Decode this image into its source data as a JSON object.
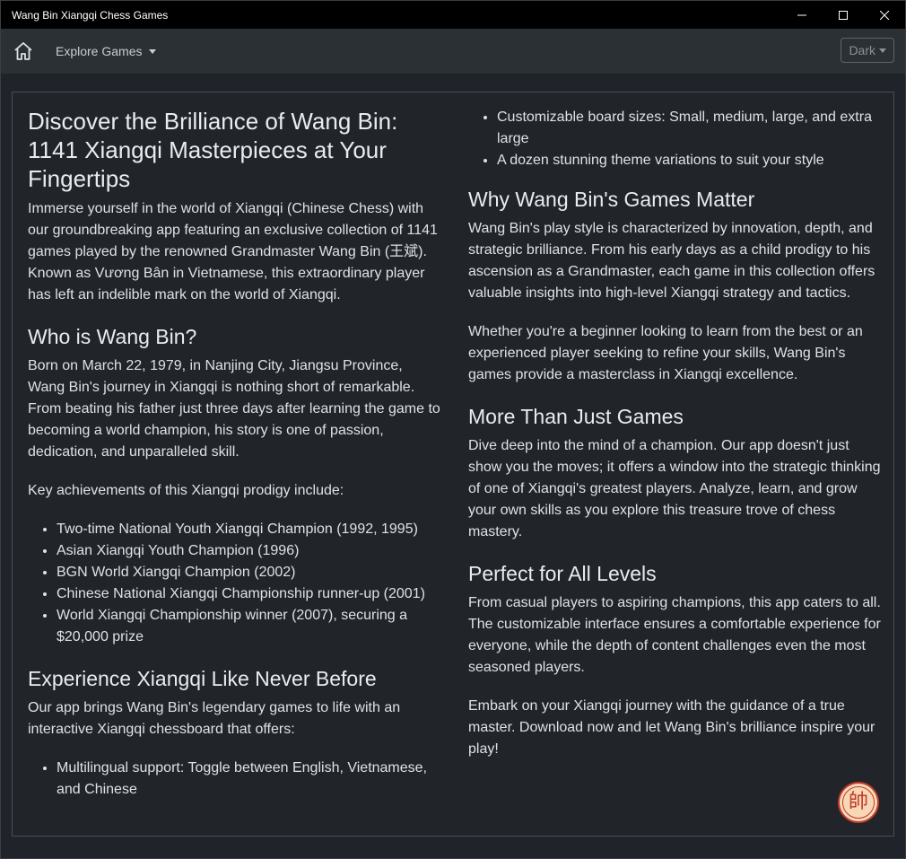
{
  "window": {
    "title": "Wang Bin Xiangqi Chess Games"
  },
  "navbar": {
    "explore_label": "Explore Games",
    "theme_label": "Dark"
  },
  "left": {
    "title": "Discover the Brilliance of Wang Bin: 1141 Xiangqi Masterpieces at Your Fingertips",
    "intro": "Immerse yourself in the world of Xiangqi (Chinese Chess) with our groundbreaking app featuring an exclusive collection of 1141 games played by the renowned Grandmaster Wang Bin (王斌). Known as Vương Bân in Vietnamese, this extraordinary player has left an indelible mark on the world of Xiangqi.",
    "who_heading": "Who is Wang Bin?",
    "who_text": "Born on March 22, 1979, in Nanjing City, Jiangsu Province, Wang Bin's journey in Xiangqi is nothing short of remarkable. From beating his father just three days after learning the game to becoming a world champion, his story is one of passion, dedication, and unparalleled skill.",
    "achievements_intro": "Key achievements of this Xiangqi prodigy include:",
    "achievements": [
      "Two-time National Youth Xiangqi Champion (1992, 1995)",
      "Asian Xiangqi Youth Champion (1996)",
      "BGN World Xiangqi Champion (2002)",
      "Chinese National Xiangqi Championship runner-up (2001)",
      "World Xiangqi Championship winner (2007), securing a $20,000 prize"
    ],
    "experience_heading": "Experience Xiangqi Like Never Before",
    "experience_text": "Our app brings Wang Bin's legendary games to life with an interactive Xiangqi chessboard that offers:",
    "features": [
      "Multilingual support: Toggle between English, Vietnamese, and Chinese"
    ]
  },
  "right": {
    "features": [
      "Customizable board sizes: Small, medium, large, and extra large",
      "A dozen stunning theme variations to suit your style"
    ],
    "why_heading": "Why Wang Bin's Games Matter",
    "why_text_1": "Wang Bin's play style is characterized by innovation, depth, and strategic brilliance. From his early days as a child prodigy to his ascension as a Grandmaster, each game in this collection offers valuable insights into high-level Xiangqi strategy and tactics.",
    "why_text_2": "Whether you're a beginner looking to learn from the best or an experienced player seeking to refine your skills, Wang Bin's games provide a masterclass in Xiangqi excellence.",
    "more_heading": "More Than Just Games",
    "more_text": "Dive deep into the mind of a champion. Our app doesn't just show you the moves; it offers a window into the strategic thinking of one of Xiangqi's greatest players. Analyze, learn, and grow your own skills as you explore this treasure trove of chess mastery.",
    "levels_heading": "Perfect for All Levels",
    "levels_text": "From casual players to aspiring champions, this app caters to all. The customizable interface ensures a comfortable experience for everyone, while the depth of content challenges even the most seasoned players.",
    "closing_text": "Embark on your Xiangqi journey with the guidance of a true master. Download now and let Wang Bin's brilliance inspire your play!"
  },
  "emblem": {
    "glyph": "帥",
    "icon": "xiangqi-general-piece-icon"
  },
  "colors": {
    "background": "#202329",
    "navbar": "#2b3035",
    "titlebar": "#000000",
    "text": "#dee2e6",
    "piece_red": "#c0392b",
    "piece_bg": "#f6d8b6"
  }
}
